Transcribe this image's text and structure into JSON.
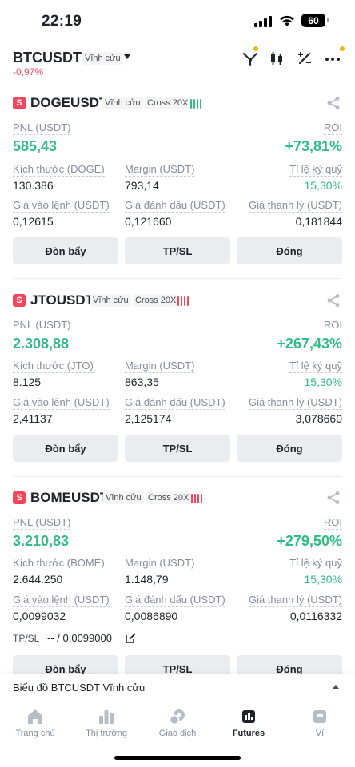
{
  "status": {
    "time": "22:19",
    "battery": "60"
  },
  "header": {
    "symbol": "BTCUSDT",
    "contract_type": "Vĩnh cửu",
    "change": "-0,97%",
    "colors": {
      "negative": "#f6465d",
      "accent": "#f0b90b"
    }
  },
  "labels": {
    "pnl": "PNL (USDT)",
    "roi": "ROI",
    "margin": "Margin (USDT)",
    "margin_ratio": "Tỉ lệ ký quỹ",
    "entry": "Giá vào lệnh (USDT)",
    "mark": "Giá đánh dấu (USDT)",
    "liq": "Giá thanh lý (USDT)",
    "leverage_btn": "Đòn bẩy",
    "tpsl_btn": "TP/SL",
    "close_btn": "Đóng"
  },
  "positions": [
    {
      "side_badge": "S",
      "symbol": "DOGEUSDT",
      "type": "Vĩnh cửu",
      "mode": "Cross 20X",
      "pnl": "585,43",
      "roi": "+73,81%",
      "size_label": "Kích thước (DOGE)",
      "size": "130.386",
      "margin": "793,14",
      "margin_ratio": "15,30%",
      "entry": "0,12615",
      "mark": "0,121660",
      "liq": "0,181844",
      "risk_color": "#2ebd85"
    },
    {
      "side_badge": "S",
      "symbol": "JTOUSDT",
      "type": "Vĩnh cửu",
      "mode": "Cross 20X",
      "pnl": "2.308,88",
      "roi": "+267,43%",
      "size_label": "Kích thước (JTO)",
      "size": "8.125",
      "margin": "863,35",
      "margin_ratio": "15,30%",
      "entry": "2,41137",
      "mark": "2,125174",
      "liq": "3,078660",
      "risk_color": "#f6465d"
    },
    {
      "side_badge": "S",
      "symbol": "BOMEUSDT",
      "type": "Vĩnh cửu",
      "mode": "Cross 20X",
      "pnl": "3.210,83",
      "roi": "+279,50%",
      "size_label": "Kích thước (BOME)",
      "size": "2.644.250",
      "margin": "1.148,79",
      "margin_ratio": "15,30%",
      "entry": "0,0099032",
      "mark": "0,0086890",
      "liq": "0,0116332",
      "tpsl_label": "TP/SL",
      "tpsl_value": "-- / 0,0099000",
      "risk_color": "#f6465d"
    }
  ],
  "chart_bar": {
    "label": "Biểu đồ BTCUSDT Vĩnh cửu"
  },
  "nav": [
    {
      "label": "Trang chủ",
      "icon": "home-icon"
    },
    {
      "label": "Thị trường",
      "icon": "markets-icon"
    },
    {
      "label": "Giao dịch",
      "icon": "trade-icon"
    },
    {
      "label": "Futures",
      "icon": "futures-icon",
      "active": true
    },
    {
      "label": "Ví",
      "icon": "wallet-icon"
    }
  ]
}
